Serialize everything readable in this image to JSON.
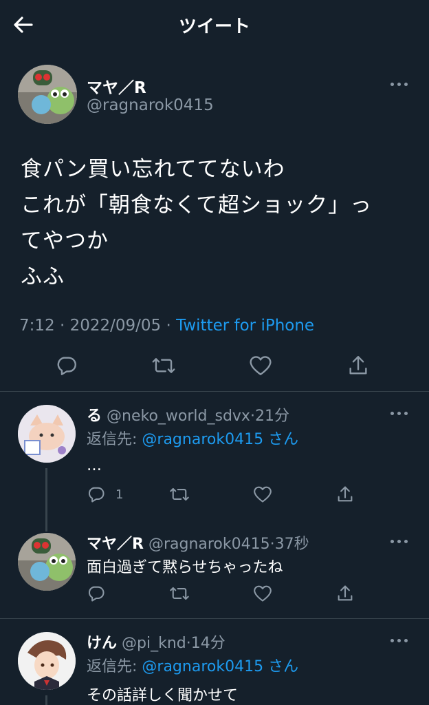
{
  "header": {
    "title": "ツイート",
    "back_icon": "arrow-left-icon"
  },
  "colors": {
    "background": "#15202b",
    "accent": "#1d9bf0",
    "muted": "#8b98a5",
    "divider": "#38444d"
  },
  "main_tweet": {
    "author_name": "マヤ／R",
    "author_handle": "@ragnarok0415",
    "text_lines": [
      "食パン買い忘れててないわ",
      "これが「朝食なくて超ショック」っ",
      "てやつか",
      "ふふ"
    ],
    "time": "7:12",
    "date": "2022/09/05",
    "source": "Twitter for iPhone",
    "sep": "·"
  },
  "replies": [
    {
      "name": "る",
      "handle": "@neko_world_sdvx",
      "age": "21分",
      "reply_to_prefix": "返信先: ",
      "reply_to_handle": "@ragnarok0415",
      "reply_to_suffix": " さん",
      "text": "…",
      "reply_count": "1"
    },
    {
      "name": "マヤ／R",
      "handle": "@ragnarok0415",
      "age": "37秒",
      "text": "面白過ぎて黙らせちゃったね"
    },
    {
      "name": "けん",
      "handle": "@pi_knd",
      "age": "14分",
      "reply_to_prefix": "返信先: ",
      "reply_to_handle": "@ragnarok0415",
      "reply_to_suffix": " さん",
      "text": "その話詳しく聞かせて"
    }
  ]
}
